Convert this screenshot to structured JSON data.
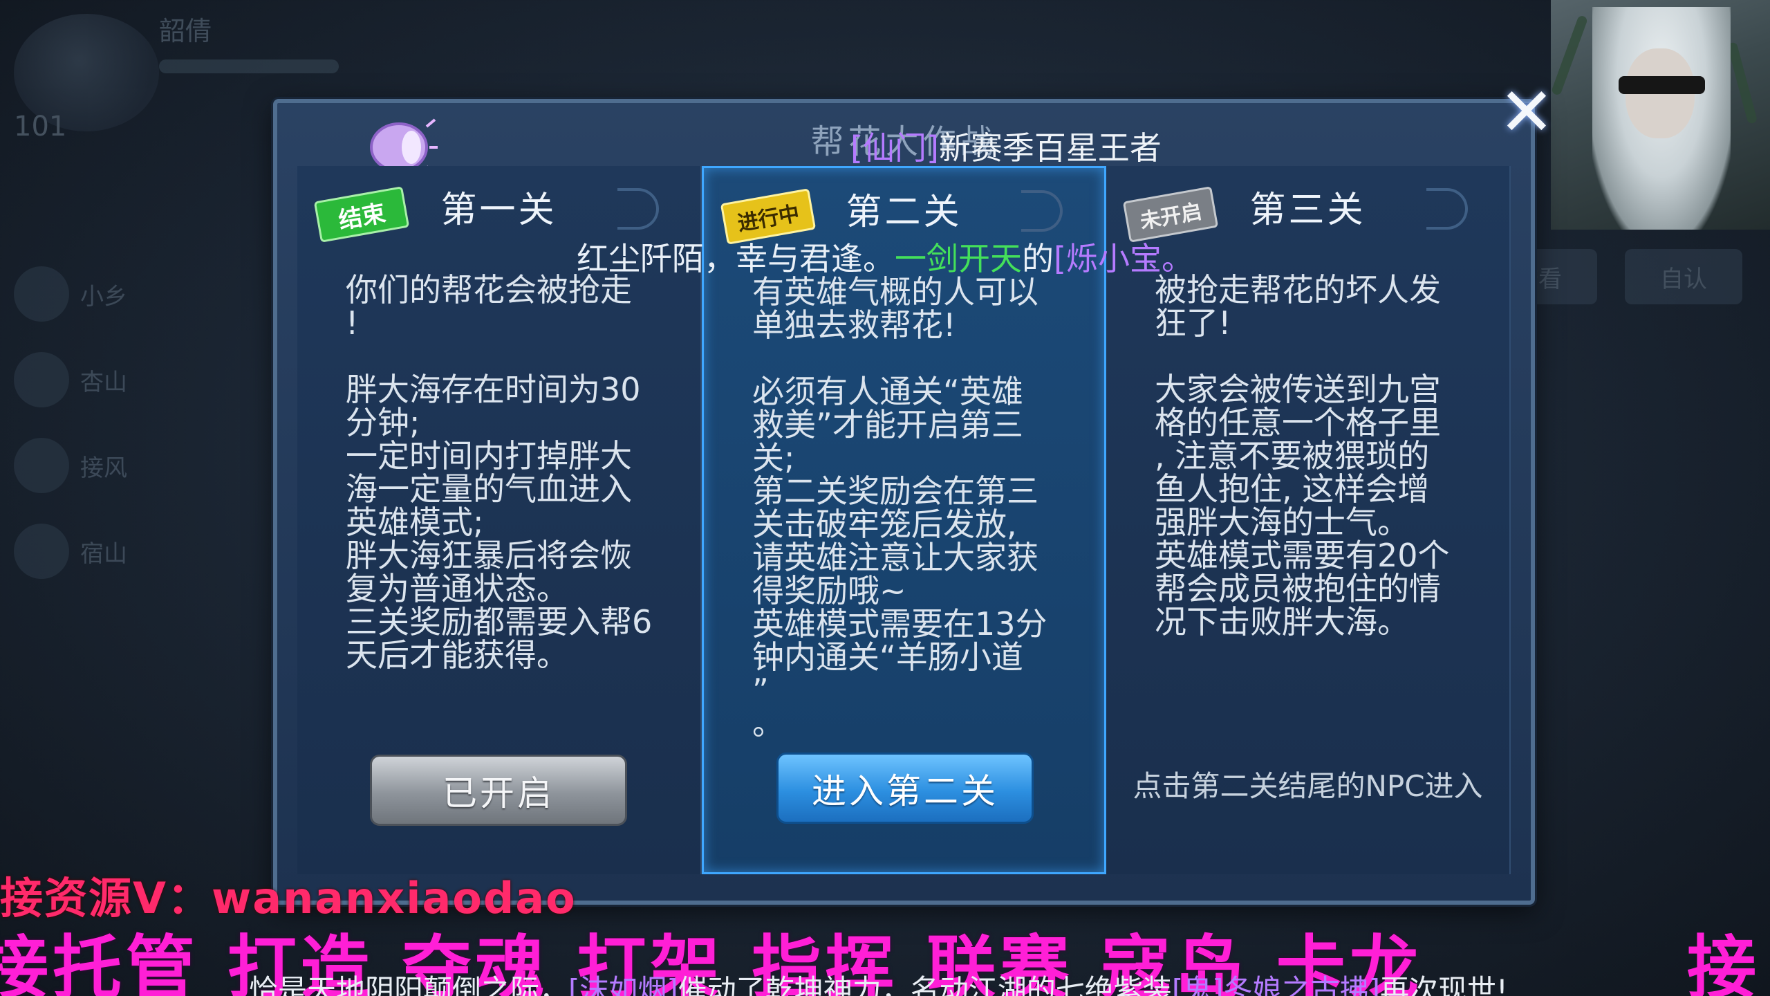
{
  "background": {
    "player_name": "韶倩",
    "player_level": "101",
    "list_items": [
      "小乡",
      "杏山",
      "接风",
      "宿山"
    ],
    "right_buttons": [
      "自认",
      "查看"
    ]
  },
  "dialog": {
    "title": "帮花大作战",
    "announcement_top": {
      "prefix": "[仙门]",
      "text": "新赛季百星王者"
    },
    "announcement_bottom": {
      "part1": "红尘阡陌，幸与君逢。",
      "part2": "一剑开天",
      "part3": "的",
      "part4": "[烁小宝。"
    },
    "stages": [
      {
        "badge": "结束",
        "badge_type": "done",
        "title": "第一关",
        "description": "你们的帮花会被抢走\n!\n\n胖大海存在时间为30\n分钟;\n一定时间内打掉胖大\n海一定量的气血进入\n英雄模式;\n胖大海狂暴后将会恢\n复为普通状态。\n三关奖励都需要入帮6\n天后才能获得。",
        "button_label": "已开启",
        "button_style": "gray"
      },
      {
        "badge": "进行中",
        "badge_type": "going",
        "title": "第二关",
        "description": "有英雄气概的人可以\n单独去救帮花!\n\n必须有人通关“英雄\n救美”才能开启第三\n关;\n第二关奖励会在第三\n关击破牢笼后发放,\n请英雄注意让大家获\n得奖励哦~\n英雄模式需要在13分\n钟内通关“羊肠小道\n”\n。",
        "button_label": "进入第二关",
        "button_style": "blue"
      },
      {
        "badge": "未开启",
        "badge_type": "locked",
        "title": "第三关",
        "description": "被抢走帮花的坏人发\n狂了!\n\n大家会被传送到九宫\n格的任意一个格子里\n, 注意不要被猥琐的\n鱼人抱住, 这样会增\n强胖大海的士气。\n英雄模式需要有20个\n帮会成员被抱住的情\n况下击败胖大海。",
        "hint": "点击第二关结尾的NPC进入"
      }
    ]
  },
  "overlay": {
    "ad_line1": "接资源V：wananxiaodao",
    "ad_line2": "接托管 打造 夺魂 打架 指挥 联赛 寇岛 卡龙",
    "ad_line2_right": "接",
    "ticker": {
      "part1": "恰是天地阴阳颠倒之际，",
      "part2": "[沫如烟]",
      "part3": "催动了乾坤神力，名动江湖的七绝紫装",
      "part4": "[鬼]冬娘之古拂]",
      "part5": "再次现世!"
    }
  },
  "colors": {
    "accent_purple": "#b57bff",
    "accent_green": "#44e05a",
    "active_border": "#3fa7ff",
    "ad_pink": "#ff1fd6"
  }
}
